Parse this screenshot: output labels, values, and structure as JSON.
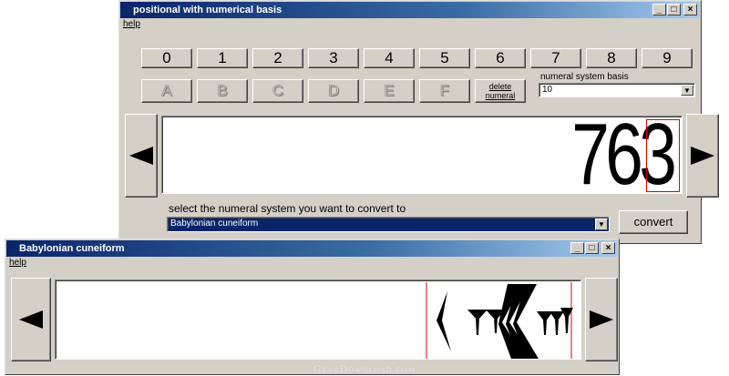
{
  "main_window": {
    "title": "positional with numerical basis",
    "menu_help": "help",
    "digits": [
      "0",
      "1",
      "2",
      "3",
      "4",
      "5",
      "6",
      "7",
      "8",
      "9"
    ],
    "letters": [
      "A",
      "B",
      "C",
      "D",
      "E",
      "F"
    ],
    "delete_line1": "delete",
    "delete_line2": "numeral",
    "basis_label": "numeral system basis",
    "basis_value": "10",
    "number_display": "763",
    "convert_label": "select the numeral system you want to convert to",
    "target_system": "Babylonian cuneiform",
    "convert_button": "convert"
  },
  "cuneiform_window": {
    "title": "Babylonian cuneiform",
    "menu_help": "help"
  },
  "titlebar_buttons": {
    "minimize": "_",
    "maximize": "□",
    "close": "×"
  },
  "watermark": "GearDownload.com"
}
